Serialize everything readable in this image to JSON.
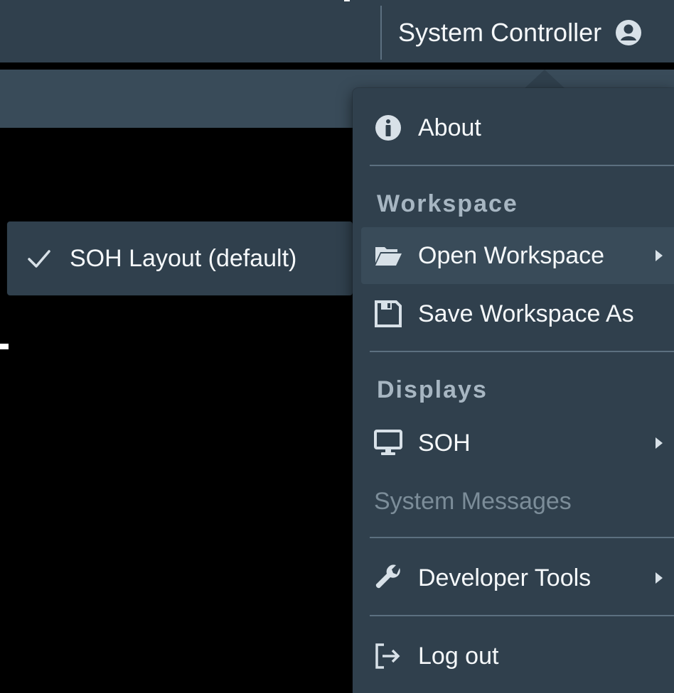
{
  "header": {
    "user_label": "System Controller",
    "user_icon": "user-circle-icon"
  },
  "submenu": {
    "selected_layout": "SOH Layout (default)",
    "check_icon": "checkmark-icon"
  },
  "menu": {
    "about": {
      "label": "About",
      "icon": "info-circle-icon"
    },
    "workspace_header": "Workspace",
    "open_workspace": {
      "label": "Open Workspace",
      "icon": "folder-open-icon"
    },
    "save_workspace_as": {
      "label": "Save Workspace As",
      "icon": "floppy-disk-icon"
    },
    "displays_header": "Displays",
    "soh": {
      "label": "SOH",
      "icon": "desktop-icon"
    },
    "system_messages": {
      "label": "System Messages"
    },
    "developer_tools": {
      "label": "Developer Tools",
      "icon": "wrench-icon"
    },
    "log_out": {
      "label": "Log out",
      "icon": "log-out-icon"
    }
  },
  "colors": {
    "menu_bg": "#30404d",
    "active_item_bg": "#394b59",
    "text": "#f5f8fa",
    "header_text": "#a7b6c2",
    "disabled_text": "#7c8d99"
  }
}
